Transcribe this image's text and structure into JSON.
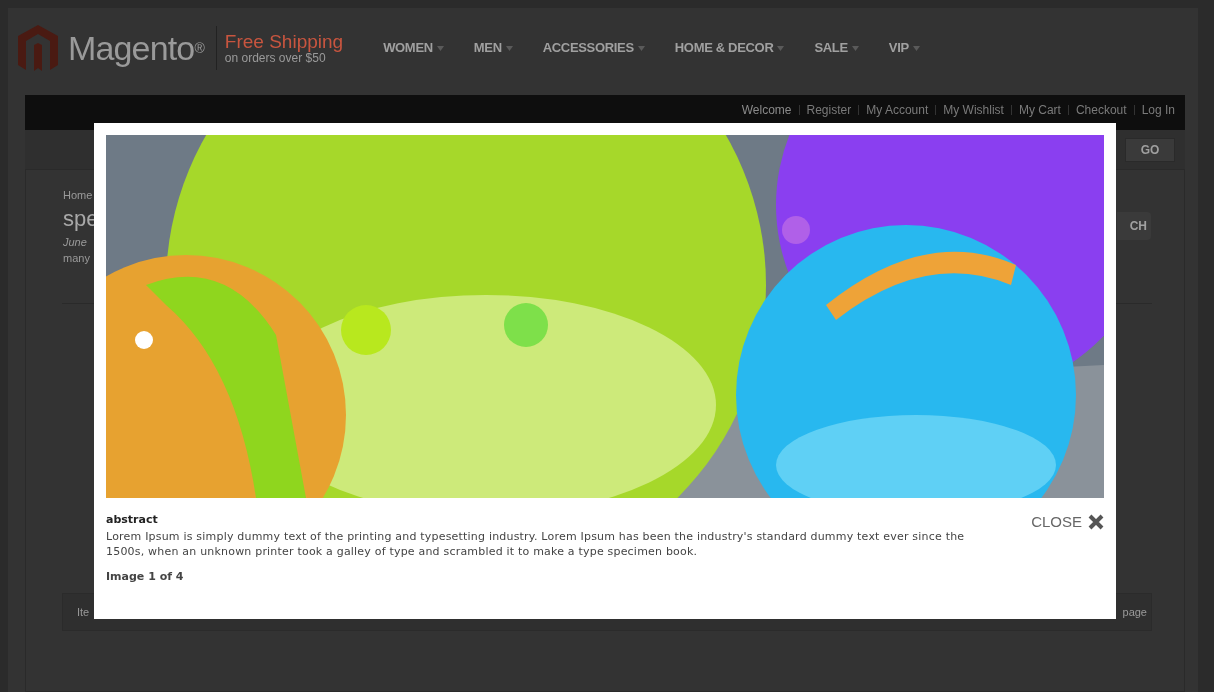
{
  "header": {
    "logo": "Magento",
    "logo_mark": "®",
    "promo_title": "Free Shipping",
    "promo_subtitle": "on orders over $50",
    "nav": [
      {
        "label": "WOMEN"
      },
      {
        "label": "MEN"
      },
      {
        "label": "ACCESSORIES"
      },
      {
        "label": "HOME & DECOR"
      },
      {
        "label": "SALE"
      },
      {
        "label": "VIP"
      }
    ]
  },
  "account_links": [
    {
      "label": "Welcome",
      "kind": "text"
    },
    {
      "label": "Register",
      "kind": "link"
    },
    {
      "label": "My Account",
      "kind": "link"
    },
    {
      "label": "My Wishlist",
      "kind": "link"
    },
    {
      "label": "My Cart",
      "kind": "link"
    },
    {
      "label": "Checkout",
      "kind": "link"
    },
    {
      "label": "Log In",
      "kind": "link"
    }
  ],
  "search": {
    "button": "GO"
  },
  "content": {
    "breadcrumb": "Home",
    "title": "spe",
    "date": "June",
    "text": "many",
    "button": "CH",
    "toolbar_left": "Ite",
    "toolbar_right": "page"
  },
  "lightbox": {
    "title": "abstract",
    "description": "Lorem Ipsum is simply dummy text of the printing and typesetting industry. Lorem Ipsum has been the industry's standard dummy text ever since the 1500s, when an unknown printer took a galley of type and scrambled it to make a type specimen book.",
    "counter": "Image 1 of 4",
    "close": "CLOSE"
  }
}
